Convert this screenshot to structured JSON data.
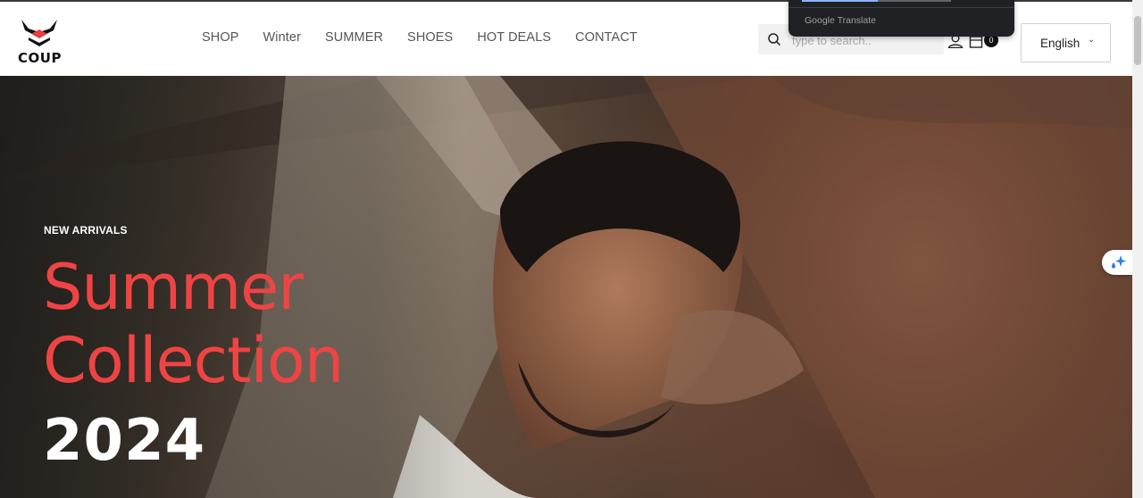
{
  "brand": {
    "name": "COUP"
  },
  "nav": {
    "items": [
      {
        "label": "SHOP"
      },
      {
        "label": "Winter"
      },
      {
        "label": "SUMMER"
      },
      {
        "label": "SHOES"
      },
      {
        "label": "HOT DEALS"
      },
      {
        "label": "CONTACT"
      }
    ]
  },
  "search": {
    "placeholder": "type to search..",
    "icon": "search-icon"
  },
  "cart": {
    "count": "0",
    "icon": "cart-icon"
  },
  "account": {
    "icon": "user-icon"
  },
  "language": {
    "selected": "English",
    "icon": "chevron-down-icon"
  },
  "translate_popup": {
    "label": "Google Translate"
  },
  "hero": {
    "eyebrow": "NEW ARRIVALS",
    "headline_line1": "Summer",
    "headline_line2": "Collection",
    "year": "2024"
  },
  "colors": {
    "accent": "#ef4444",
    "text_dark": "#111111",
    "nav_text": "#555555"
  }
}
